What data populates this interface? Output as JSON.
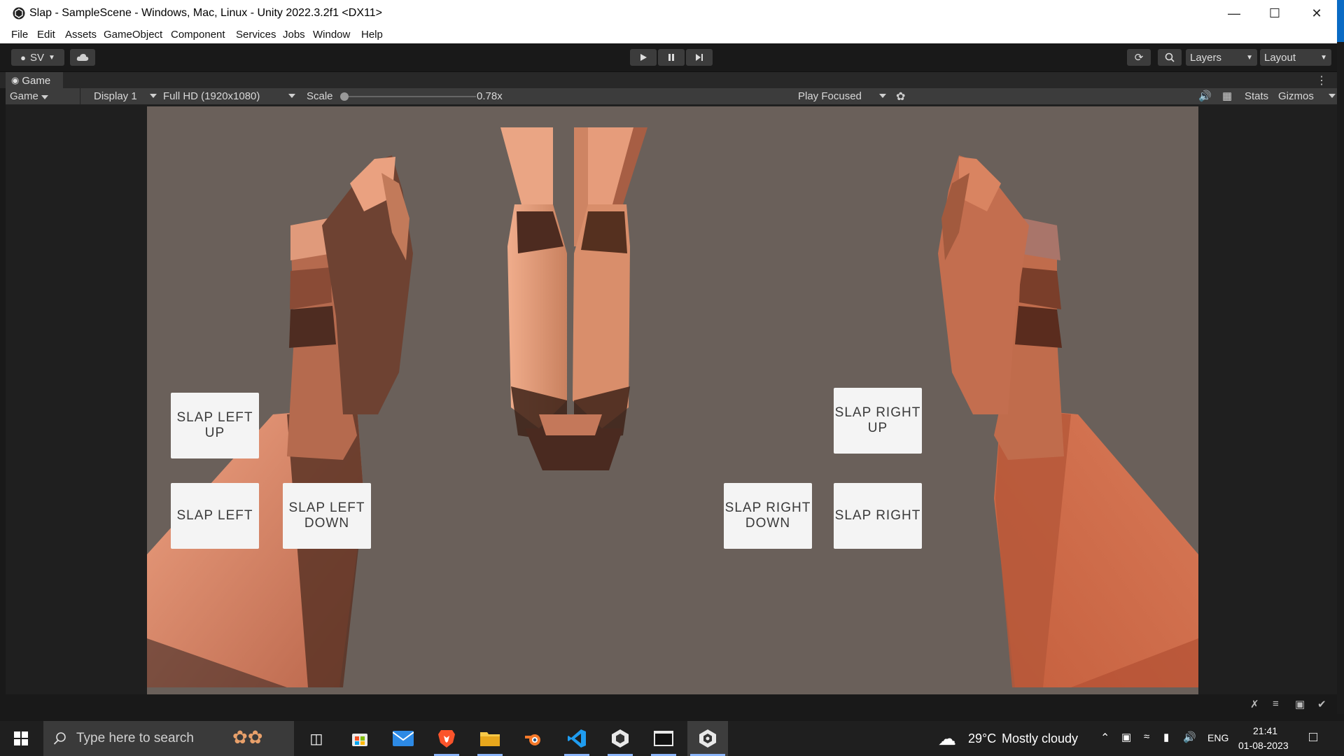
{
  "window": {
    "title": "Slap - SampleScene - Windows, Mac, Linux - Unity 2022.3.2f1 <DX11>",
    "controls": [
      "minimize",
      "maximize",
      "close"
    ]
  },
  "menu": [
    "File",
    "Edit",
    "Assets",
    "GameObject",
    "Component",
    "Services",
    "Jobs",
    "Window",
    "Help"
  ],
  "toolbar": {
    "account_label": "SV",
    "layers_label": "Layers",
    "layout_label": "Layout"
  },
  "game_tab": {
    "label": "Game"
  },
  "game_bar": {
    "view_select": "Game",
    "display_select": "Display 1",
    "resolution_select": "Full HD (1920x1080)",
    "scale_label": "Scale",
    "scale_value": "0.78x",
    "play_mode_select": "Play Focused",
    "stats_label": "Stats",
    "gizmos_label": "Gizmos"
  },
  "buttons": {
    "slap_left_up": "SLAP LEFT UP",
    "slap_left": "SLAP LEFT",
    "slap_left_down": "SLAP LEFT\nDOWN",
    "slap_right_up": "SLAP RIGHT\nUP",
    "slap_right_down": "SLAP RIGHT\nDOWN",
    "slap_right": "SLAP RIGHT"
  },
  "taskbar": {
    "search_placeholder": "Type here to search",
    "weather_temp": "29°C",
    "weather_text": "Mostly cloudy",
    "language": "ENG",
    "time": "21:41",
    "date": "01-08-2023"
  },
  "colors": {
    "viewport_bg": "#6a605a",
    "skin_light": "#e8a07e",
    "skin_dark": "#6b3e2c",
    "button_bg": "#f4f4f4"
  }
}
